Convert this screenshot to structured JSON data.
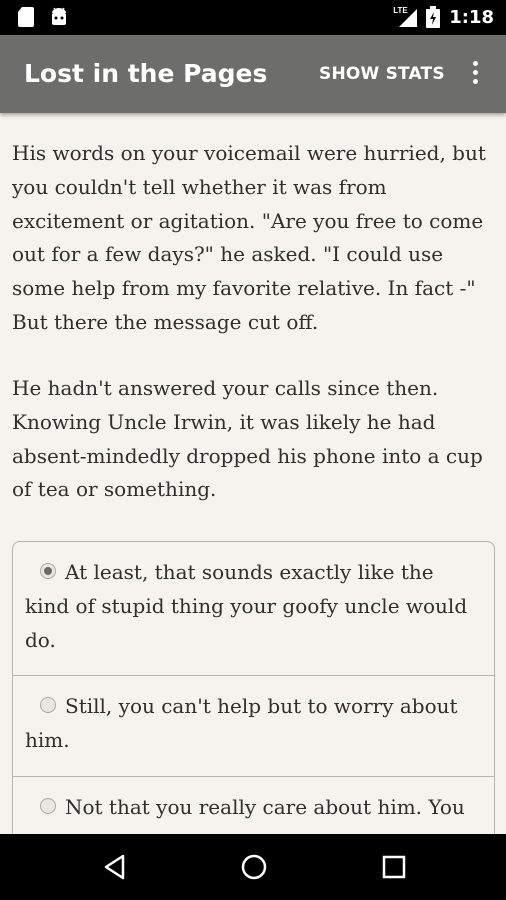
{
  "status_bar": {
    "time": "1:18",
    "network": "LTE",
    "icons": [
      "sd-card-icon",
      "android-icon",
      "signal-icon",
      "battery-icon"
    ]
  },
  "app_bar": {
    "title": "Lost in the Pages",
    "action_label": "SHOW STATS",
    "menu_icon": "overflow-menu-icon"
  },
  "story": {
    "paragraphs": [
      "His words on your voicemail were hurried, but you couldn't tell whether it was from excitement or agitation. \"Are you free to come out for a few days?\" he asked. \"I could use some help from my favorite relative. In fact -\" But there the message cut off.",
      "He hadn't answered your calls since then. Knowing Uncle Irwin, it was likely he had absent-mindedly dropped his phone into a cup of tea or something."
    ]
  },
  "choices": [
    {
      "label": "At least, that sounds exactly like the kind of stupid thing your goofy uncle would do.",
      "selected": true
    },
    {
      "label": "Still, you can't help but to worry about him.",
      "selected": false
    },
    {
      "label": "Not that you really care about him. You",
      "selected": false
    }
  ],
  "nav_bar": {
    "buttons": [
      "back-icon",
      "home-icon",
      "recents-icon"
    ]
  },
  "colors": {
    "app_bar": "#6d6d6b",
    "background": "#f6f3ee",
    "text": "#2e2e2e"
  }
}
